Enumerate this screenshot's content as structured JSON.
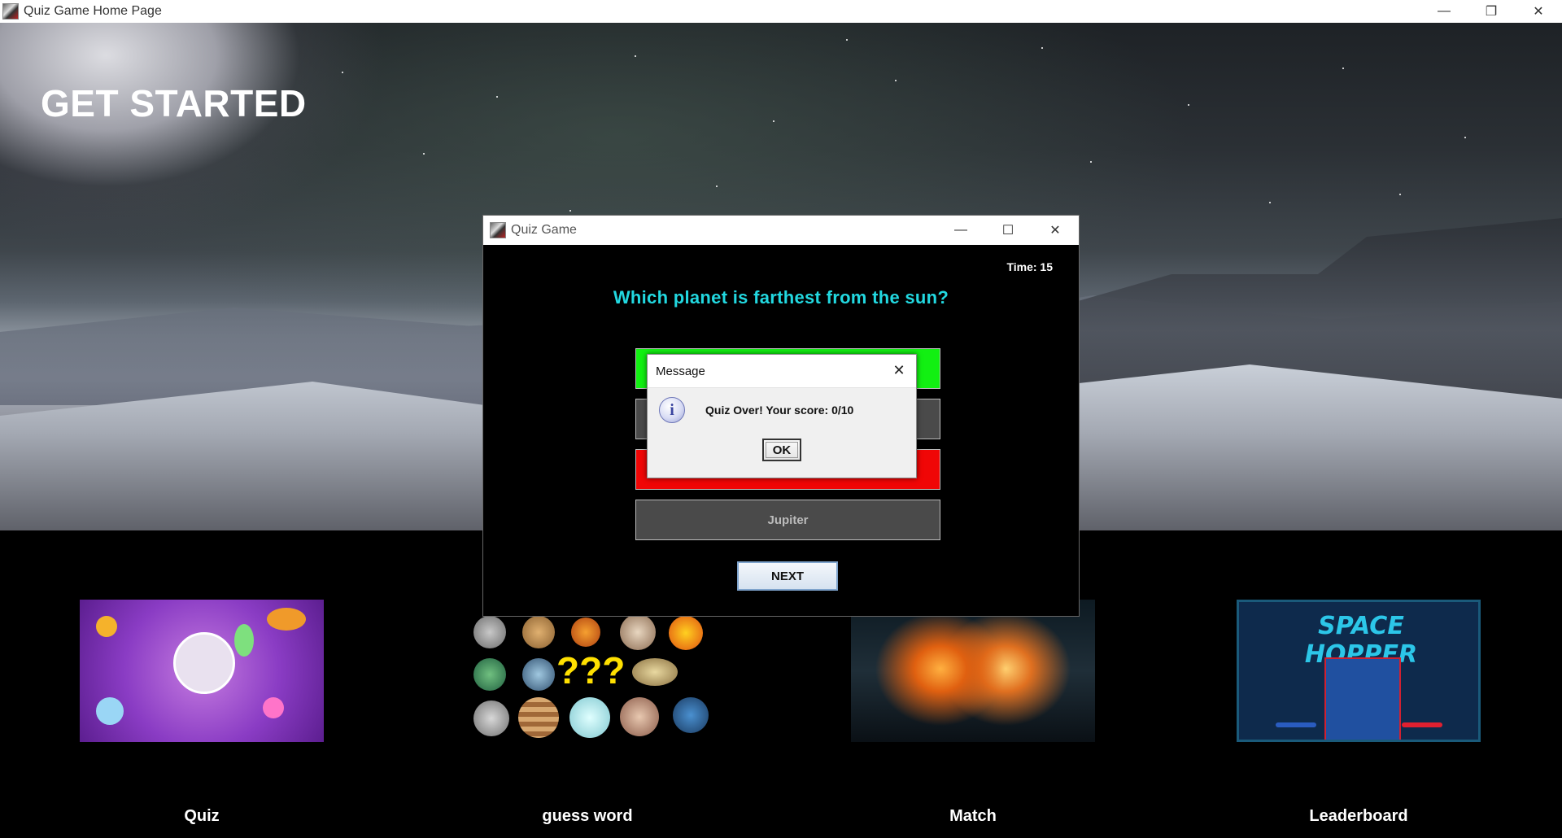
{
  "main_window": {
    "title": "Quiz Game Home Page",
    "minimize_glyph": "—",
    "restore_glyph": "❐",
    "close_glyph": "✕"
  },
  "hero": {
    "heading": "GET STARTED"
  },
  "cards": [
    {
      "label": "Quiz",
      "image": "space-trivia-image"
    },
    {
      "label": "guess word",
      "image": "planets-question-image"
    },
    {
      "label": "Match",
      "image": "colliding-stars-image"
    },
    {
      "label": "Leaderboard",
      "image": "space-hopper-leaderboard-image"
    }
  ],
  "quiz_dialog": {
    "title": "Quiz Game",
    "minimize_glyph": "—",
    "maximize_glyph": "☐",
    "close_glyph": "✕",
    "timer": "Time: 15",
    "question": "Which planet is farthest from the sun?",
    "options": [
      {
        "label": "",
        "state": "correct",
        "color": "#12f012"
      },
      {
        "label": "",
        "state": "neutral",
        "color": "#4a4a4a"
      },
      {
        "label": "",
        "state": "wrong",
        "color": "#f00606"
      },
      {
        "label": "Jupiter",
        "state": "neutral",
        "color": "#4a4a4a"
      }
    ],
    "next_label": "NEXT"
  },
  "message_dialog": {
    "title": "Message",
    "close_glyph": "✕",
    "icon": "info-icon",
    "icon_glyph": "i",
    "text": "Quiz Over! Your score: 0/10",
    "ok_label": "OK"
  }
}
